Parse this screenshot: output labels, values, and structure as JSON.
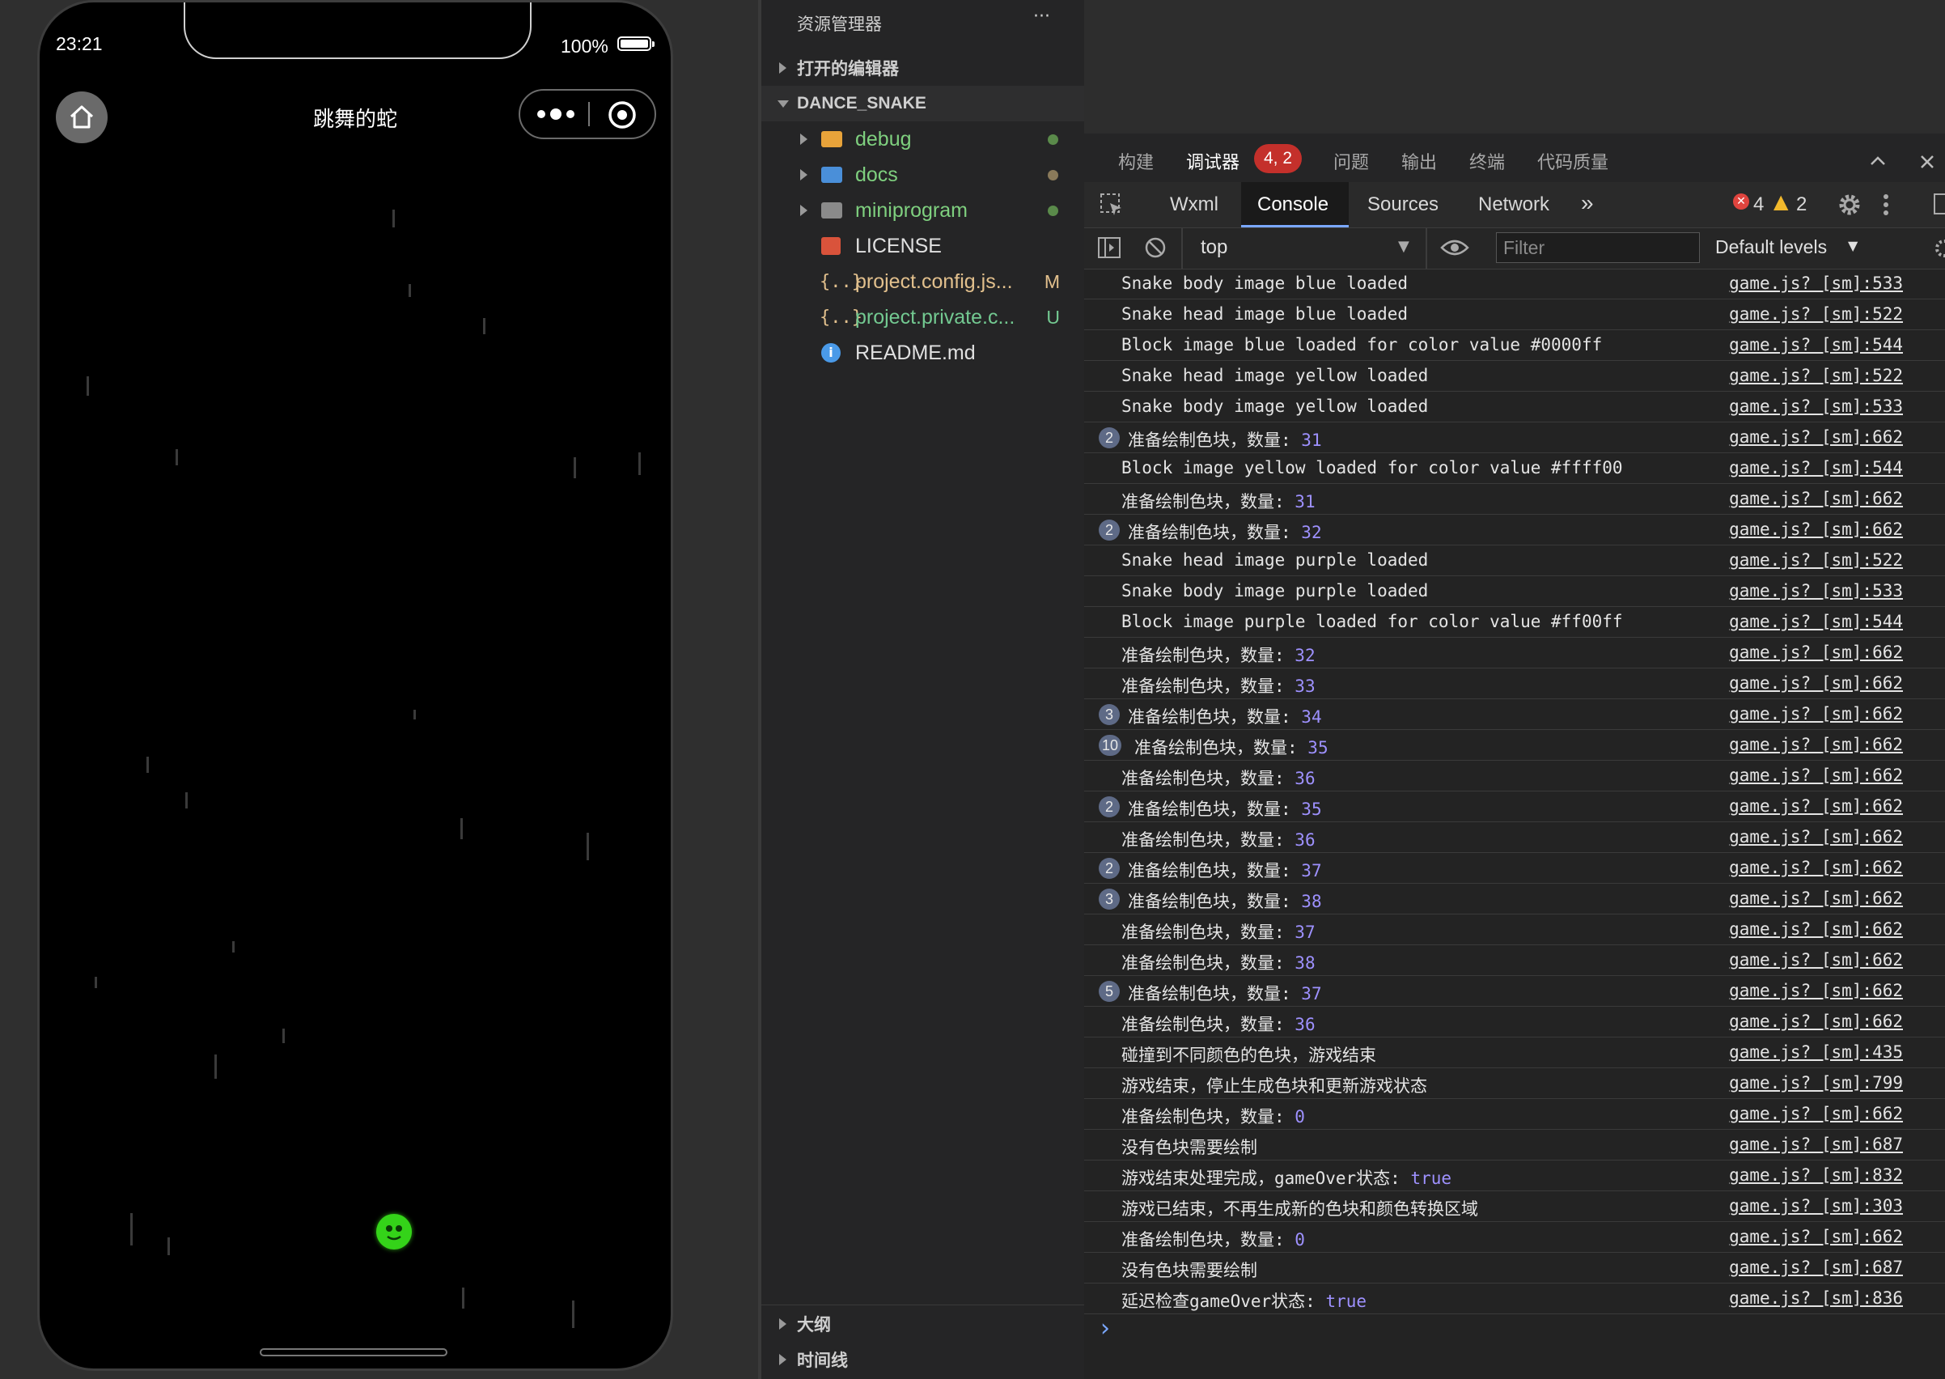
{
  "simulator": {
    "time": "23:21",
    "battery": "100%",
    "title": "跳舞的蛇"
  },
  "explorer": {
    "header": "资源管理器",
    "more": "···",
    "open_editors": "打开的编辑器",
    "project": "DANCE_SNAKE",
    "items": [
      {
        "name": "debug",
        "type": "folder",
        "color": "#7fd07f",
        "status": "dot",
        "status_color": "#5a8a4a"
      },
      {
        "name": "docs",
        "type": "folder",
        "color": "#7fd07f",
        "status": "dot",
        "status_color": "#8a7a5a"
      },
      {
        "name": "miniprogram",
        "type": "folder",
        "color": "#7fd07f",
        "status": "dot",
        "status_color": "#5a8a4a"
      },
      {
        "name": "LICENSE",
        "type": "file",
        "color": "#e0e0e0"
      },
      {
        "name": "project.config.js...",
        "type": "json",
        "color": "#e2c08d",
        "status": "M"
      },
      {
        "name": "project.private.c...",
        "type": "json",
        "color": "#73c991",
        "status": "U"
      },
      {
        "name": "README.md",
        "type": "info",
        "color": "#e0e0e0"
      }
    ],
    "outline": "大纲",
    "timeline": "时间线"
  },
  "devtools": {
    "top_tabs": [
      "构建",
      "调试器",
      "问题",
      "输出",
      "终端",
      "代码质量"
    ],
    "debugger_badge": "4, 2",
    "panel_tabs": [
      "Wxml",
      "Console",
      "Sources",
      "Network"
    ],
    "more_tabs": "»",
    "error_count": "4",
    "warning_count": "2",
    "context": "top",
    "filter_placeholder": "Filter",
    "levels": "Default levels",
    "prompt": "›",
    "logs": [
      {
        "count": "",
        "text": "Snake body image blue loaded",
        "num": "",
        "src": "game.js? [sm]:533"
      },
      {
        "count": "",
        "text": "Snake head image blue loaded",
        "num": "",
        "src": "game.js? [sm]:522"
      },
      {
        "count": "",
        "text": "Block image blue loaded for color value #0000ff",
        "num": "",
        "src": "game.js? [sm]:544"
      },
      {
        "count": "",
        "text": "Snake head image yellow loaded",
        "num": "",
        "src": "game.js? [sm]:522"
      },
      {
        "count": "",
        "text": "Snake body image yellow loaded",
        "num": "",
        "src": "game.js? [sm]:533"
      },
      {
        "count": "2",
        "text": "准备绘制色块，数量: ",
        "num": "31",
        "src": "game.js? [sm]:662"
      },
      {
        "count": "",
        "text": "Block image yellow loaded for color value #ffff00",
        "num": "",
        "src": "game.js? [sm]:544"
      },
      {
        "count": "",
        "text": "准备绘制色块，数量: ",
        "num": "31",
        "src": "game.js? [sm]:662"
      },
      {
        "count": "2",
        "text": "准备绘制色块，数量: ",
        "num": "32",
        "src": "game.js? [sm]:662"
      },
      {
        "count": "",
        "text": "Snake head image purple loaded",
        "num": "",
        "src": "game.js? [sm]:522"
      },
      {
        "count": "",
        "text": "Snake body image purple loaded",
        "num": "",
        "src": "game.js? [sm]:533"
      },
      {
        "count": "",
        "text": "Block image purple loaded for color value #ff00ff",
        "num": "",
        "src": "game.js? [sm]:544"
      },
      {
        "count": "",
        "text": "准备绘制色块，数量: ",
        "num": "32",
        "src": "game.js? [sm]:662"
      },
      {
        "count": "",
        "text": "准备绘制色块，数量: ",
        "num": "33",
        "src": "game.js? [sm]:662"
      },
      {
        "count": "3",
        "text": "准备绘制色块，数量: ",
        "num": "34",
        "src": "game.js? [sm]:662"
      },
      {
        "count": "10",
        "text": "准备绘制色块，数量: ",
        "num": "35",
        "src": "game.js? [sm]:662"
      },
      {
        "count": "",
        "text": "准备绘制色块，数量: ",
        "num": "36",
        "src": "game.js? [sm]:662"
      },
      {
        "count": "2",
        "text": "准备绘制色块，数量: ",
        "num": "35",
        "src": "game.js? [sm]:662"
      },
      {
        "count": "",
        "text": "准备绘制色块，数量: ",
        "num": "36",
        "src": "game.js? [sm]:662"
      },
      {
        "count": "2",
        "text": "准备绘制色块，数量: ",
        "num": "37",
        "src": "game.js? [sm]:662"
      },
      {
        "count": "3",
        "text": "准备绘制色块，数量: ",
        "num": "38",
        "src": "game.js? [sm]:662"
      },
      {
        "count": "",
        "text": "准备绘制色块，数量: ",
        "num": "37",
        "src": "game.js? [sm]:662"
      },
      {
        "count": "",
        "text": "准备绘制色块，数量: ",
        "num": "38",
        "src": "game.js? [sm]:662"
      },
      {
        "count": "5",
        "text": "准备绘制色块，数量: ",
        "num": "37",
        "src": "game.js? [sm]:662"
      },
      {
        "count": "",
        "text": "准备绘制色块，数量: ",
        "num": "36",
        "src": "game.js? [sm]:662"
      },
      {
        "count": "",
        "text": "碰撞到不同颜色的色块，游戏结束",
        "num": "",
        "src": "game.js? [sm]:435"
      },
      {
        "count": "",
        "text": "游戏结束，停止生成色块和更新游戏状态",
        "num": "",
        "src": "game.js? [sm]:799"
      },
      {
        "count": "",
        "text": "准备绘制色块，数量: ",
        "num": "0",
        "src": "game.js? [sm]:662"
      },
      {
        "count": "",
        "text": "没有色块需要绘制",
        "num": "",
        "src": "game.js? [sm]:687"
      },
      {
        "count": "",
        "text": "游戏结束处理完成，gameOver状态: ",
        "num": "true",
        "src": "game.js? [sm]:832"
      },
      {
        "count": "",
        "text": "游戏已结束，不再生成新的色块和颜色转换区域",
        "num": "",
        "src": "game.js? [sm]:303"
      },
      {
        "count": "",
        "text": "准备绘制色块，数量: ",
        "num": "0",
        "src": "game.js? [sm]:662"
      },
      {
        "count": "",
        "text": "没有色块需要绘制",
        "num": "",
        "src": "game.js? [sm]:687"
      },
      {
        "count": "",
        "text": "延迟检查gameOver状态: ",
        "num": "true",
        "src": "game.js? [sm]:836"
      }
    ]
  }
}
